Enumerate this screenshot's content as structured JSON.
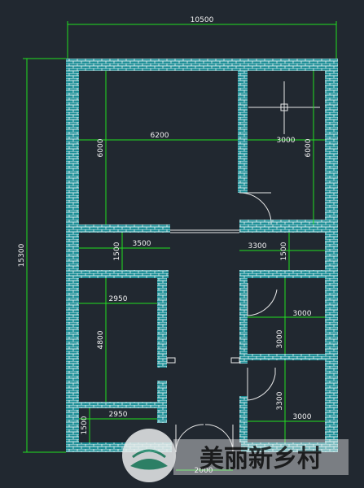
{
  "overall": {
    "width_label": "10500",
    "height_label": "15300"
  },
  "rooms": {
    "upper_left": {
      "width_label": "6200",
      "height_label": "6000"
    },
    "upper_right": {
      "width_label": "3000",
      "height_label": "6000"
    },
    "corridor_left": {
      "width_label": "3500",
      "height_label": "1500"
    },
    "corridor_right": {
      "width_label": "3300",
      "height_label": "1500"
    },
    "lower_left": {
      "width_label": "2950",
      "height_label": "4800"
    },
    "lower_left_small": {
      "width_label": "2950",
      "height_label": "1500"
    },
    "lower_right_mid": {
      "width_label": "3000",
      "height_label": "3000"
    },
    "lower_right_bottom": {
      "width_label": "3000",
      "height_label": "3300"
    },
    "entrance": {
      "width_label": "2000"
    }
  },
  "watermark": {
    "text": "美丽新乡村"
  },
  "colors": {
    "background": "#212830",
    "wall_fill": "#1e8f97",
    "brick_line": "#ffffff",
    "dimension_line": "#21e021",
    "door_line": "#ffffff"
  }
}
